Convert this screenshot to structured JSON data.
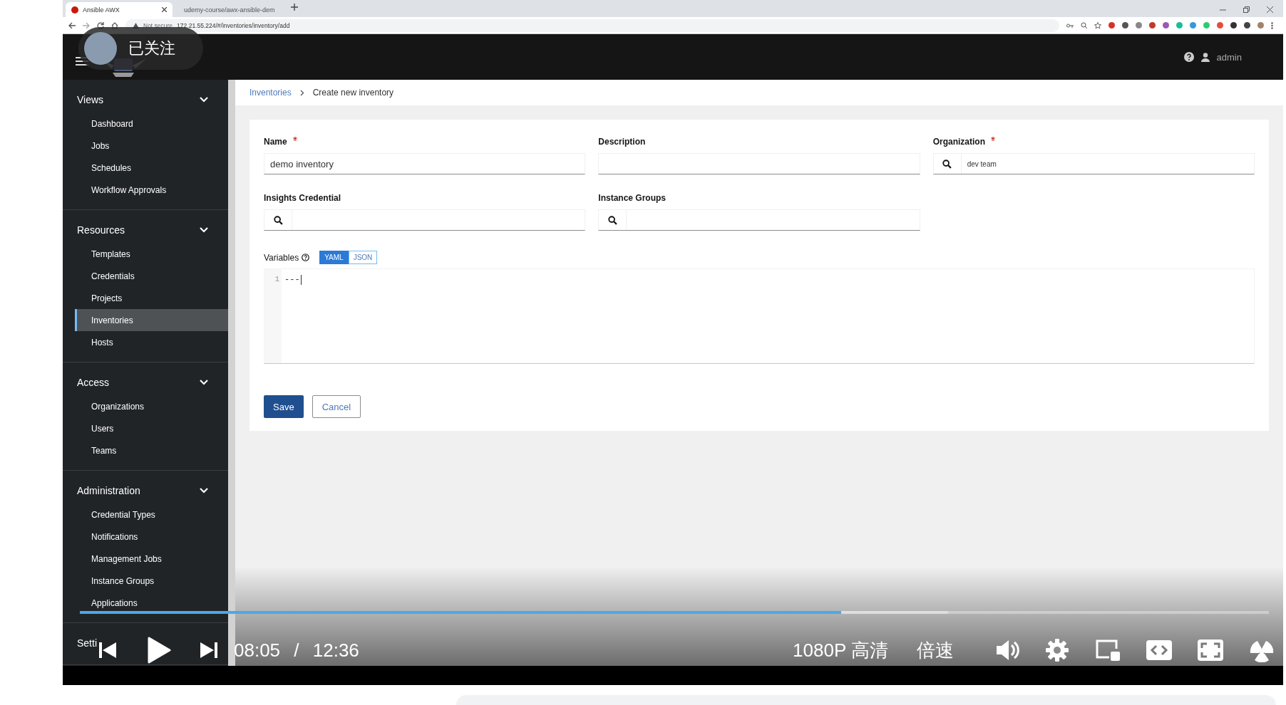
{
  "browser": {
    "tabs": [
      {
        "title": "Ansible AWX",
        "selected": true
      },
      {
        "title": "udemy-course/awx-ansible-dem",
        "selected": false
      }
    ],
    "security": "Not secure",
    "url": "172.21.55.224/#/inventories/inventory/add"
  },
  "follow_badge": {
    "label": "已关注"
  },
  "header": {
    "user": "admin"
  },
  "sidebar": {
    "sections": [
      {
        "title": "Views",
        "expanded": true,
        "items": [
          {
            "label": "Dashboard",
            "selected": false
          },
          {
            "label": "Jobs",
            "selected": false
          },
          {
            "label": "Schedules",
            "selected": false
          },
          {
            "label": "Workflow Approvals",
            "selected": false
          }
        ]
      },
      {
        "title": "Resources",
        "expanded": true,
        "items": [
          {
            "label": "Templates",
            "selected": false
          },
          {
            "label": "Credentials",
            "selected": false
          },
          {
            "label": "Projects",
            "selected": false
          },
          {
            "label": "Inventories",
            "selected": true
          },
          {
            "label": "Hosts",
            "selected": false
          }
        ]
      },
      {
        "title": "Access",
        "expanded": true,
        "items": [
          {
            "label": "Organizations",
            "selected": false
          },
          {
            "label": "Users",
            "selected": false
          },
          {
            "label": "Teams",
            "selected": false
          }
        ]
      },
      {
        "title": "Administration",
        "expanded": true,
        "items": [
          {
            "label": "Credential Types",
            "selected": false
          },
          {
            "label": "Notifications",
            "selected": false
          },
          {
            "label": "Management Jobs",
            "selected": false
          },
          {
            "label": "Instance Groups",
            "selected": false
          },
          {
            "label": "Applications",
            "selected": false
          }
        ]
      },
      {
        "title": "Setti"
      }
    ]
  },
  "breadcrumb": [
    "Inventories",
    "Create new inventory"
  ],
  "form": {
    "fields": [
      {
        "label": "Name",
        "required": true,
        "kind": "text",
        "value": "demo inventory"
      },
      {
        "label": "Description",
        "required": false,
        "kind": "text"
      },
      {
        "label": "Organization",
        "required": true,
        "kind": "lookup",
        "value": "dev team"
      },
      {
        "label": "Insights Credential",
        "required": false,
        "kind": "lookup"
      },
      {
        "label": "Instance Groups",
        "required": false,
        "kind": "lookup"
      }
    ],
    "variables": {
      "label": "Variables",
      "modes": [
        {
          "label": "YAML",
          "selected": true
        },
        {
          "label": "JSON",
          "selected": false
        }
      ],
      "lines": [
        {
          "number": "1",
          "text": "---"
        }
      ]
    },
    "buttons": [
      {
        "label": "Save",
        "kind": "primary"
      },
      {
        "label": "Cancel",
        "kind": "secondary"
      }
    ]
  },
  "player": {
    "level": 0.64,
    "time": "08:05 / 12:36",
    "quality": "1080P 高清",
    "speed": "倍速"
  }
}
